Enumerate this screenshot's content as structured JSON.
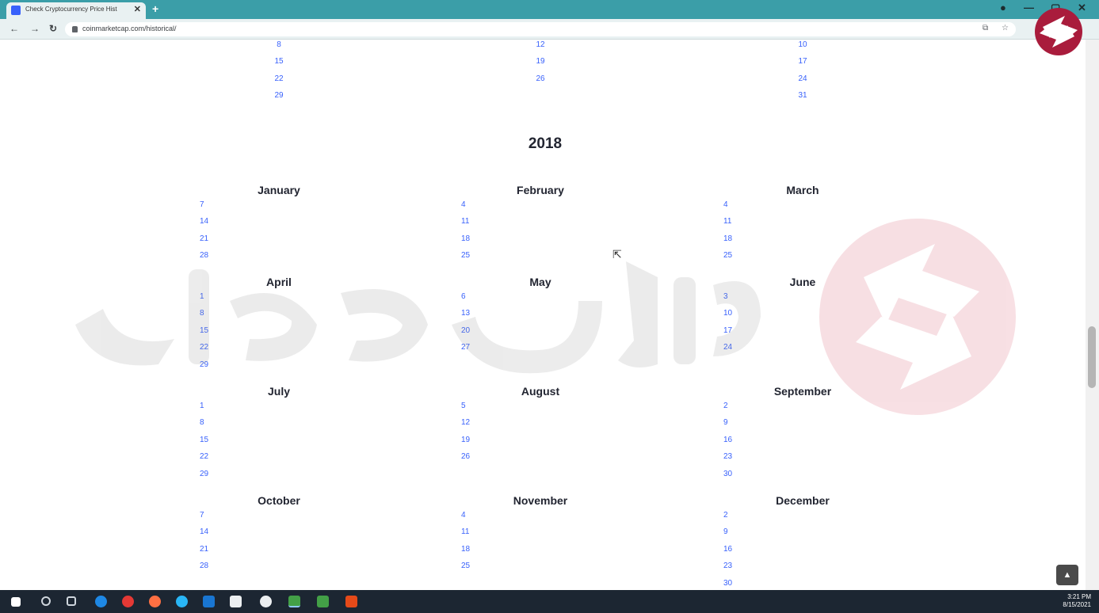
{
  "browser": {
    "tab_title": "Check Cryptocurrency Price Hist",
    "tab_close": "✕",
    "new_tab": "+",
    "url": "coinmarketcap.com/historical/",
    "controls": {
      "minimize": "—",
      "maximize": "▢",
      "close": "✕"
    }
  },
  "prev_tail": {
    "col1": [
      "8",
      "15",
      "22",
      "29"
    ],
    "col2": [
      "12",
      "19",
      "26"
    ],
    "col3": [
      "10",
      "17",
      "24",
      "31"
    ]
  },
  "year": "2018",
  "months": [
    {
      "name": "January",
      "days": [
        "7",
        "14",
        "21",
        "28"
      ]
    },
    {
      "name": "February",
      "days": [
        "4",
        "11",
        "18",
        "25"
      ]
    },
    {
      "name": "March",
      "days": [
        "4",
        "11",
        "18",
        "25"
      ]
    },
    {
      "name": "April",
      "days": [
        "1",
        "8",
        "15",
        "22",
        "29"
      ]
    },
    {
      "name": "May",
      "days": [
        "6",
        "13",
        "20",
        "27"
      ]
    },
    {
      "name": "June",
      "days": [
        "3",
        "10",
        "17",
        "24"
      ]
    },
    {
      "name": "July",
      "days": [
        "1",
        "8",
        "15",
        "22",
        "29"
      ]
    },
    {
      "name": "August",
      "days": [
        "5",
        "12",
        "19",
        "26"
      ]
    },
    {
      "name": "September",
      "days": [
        "2",
        "9",
        "16",
        "23",
        "30"
      ]
    },
    {
      "name": "October",
      "days": [
        "7",
        "14",
        "21",
        "28"
      ]
    },
    {
      "name": "November",
      "days": [
        "4",
        "11",
        "18",
        "25"
      ]
    },
    {
      "name": "December",
      "days": [
        "2",
        "9",
        "16",
        "23",
        "30"
      ]
    }
  ],
  "watermark_text": "فارکس حرفه‌ای",
  "back_to_top": "▲",
  "taskbar": {
    "time": "3:21 PM",
    "date": "8/15/2021"
  },
  "colors": {
    "link": "#3861fb",
    "chrome": "#3b9ea8",
    "watermark": "#c8102e"
  }
}
